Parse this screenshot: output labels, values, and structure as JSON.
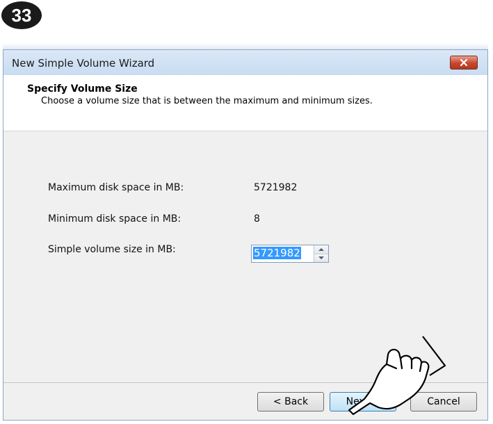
{
  "step_badge": "33",
  "window": {
    "title": "New Simple Volume Wizard",
    "close_icon": "close-icon"
  },
  "header": {
    "title": "Specify Volume Size",
    "subtitle": "Choose a volume size that is between the maximum and minimum sizes."
  },
  "fields": {
    "max_label": "Maximum disk space in MB:",
    "max_value": "5721982",
    "min_label": "Minimum disk space in MB:",
    "min_value": "8",
    "size_label": "Simple volume size in MB:",
    "size_value": "5721982"
  },
  "buttons": {
    "back": "< Back",
    "next": "Next >",
    "cancel": "Cancel"
  },
  "icons": {
    "pointer": "hand-pointer-icon",
    "spin_up": "chevron-up-icon",
    "spin_down": "chevron-down-icon"
  }
}
